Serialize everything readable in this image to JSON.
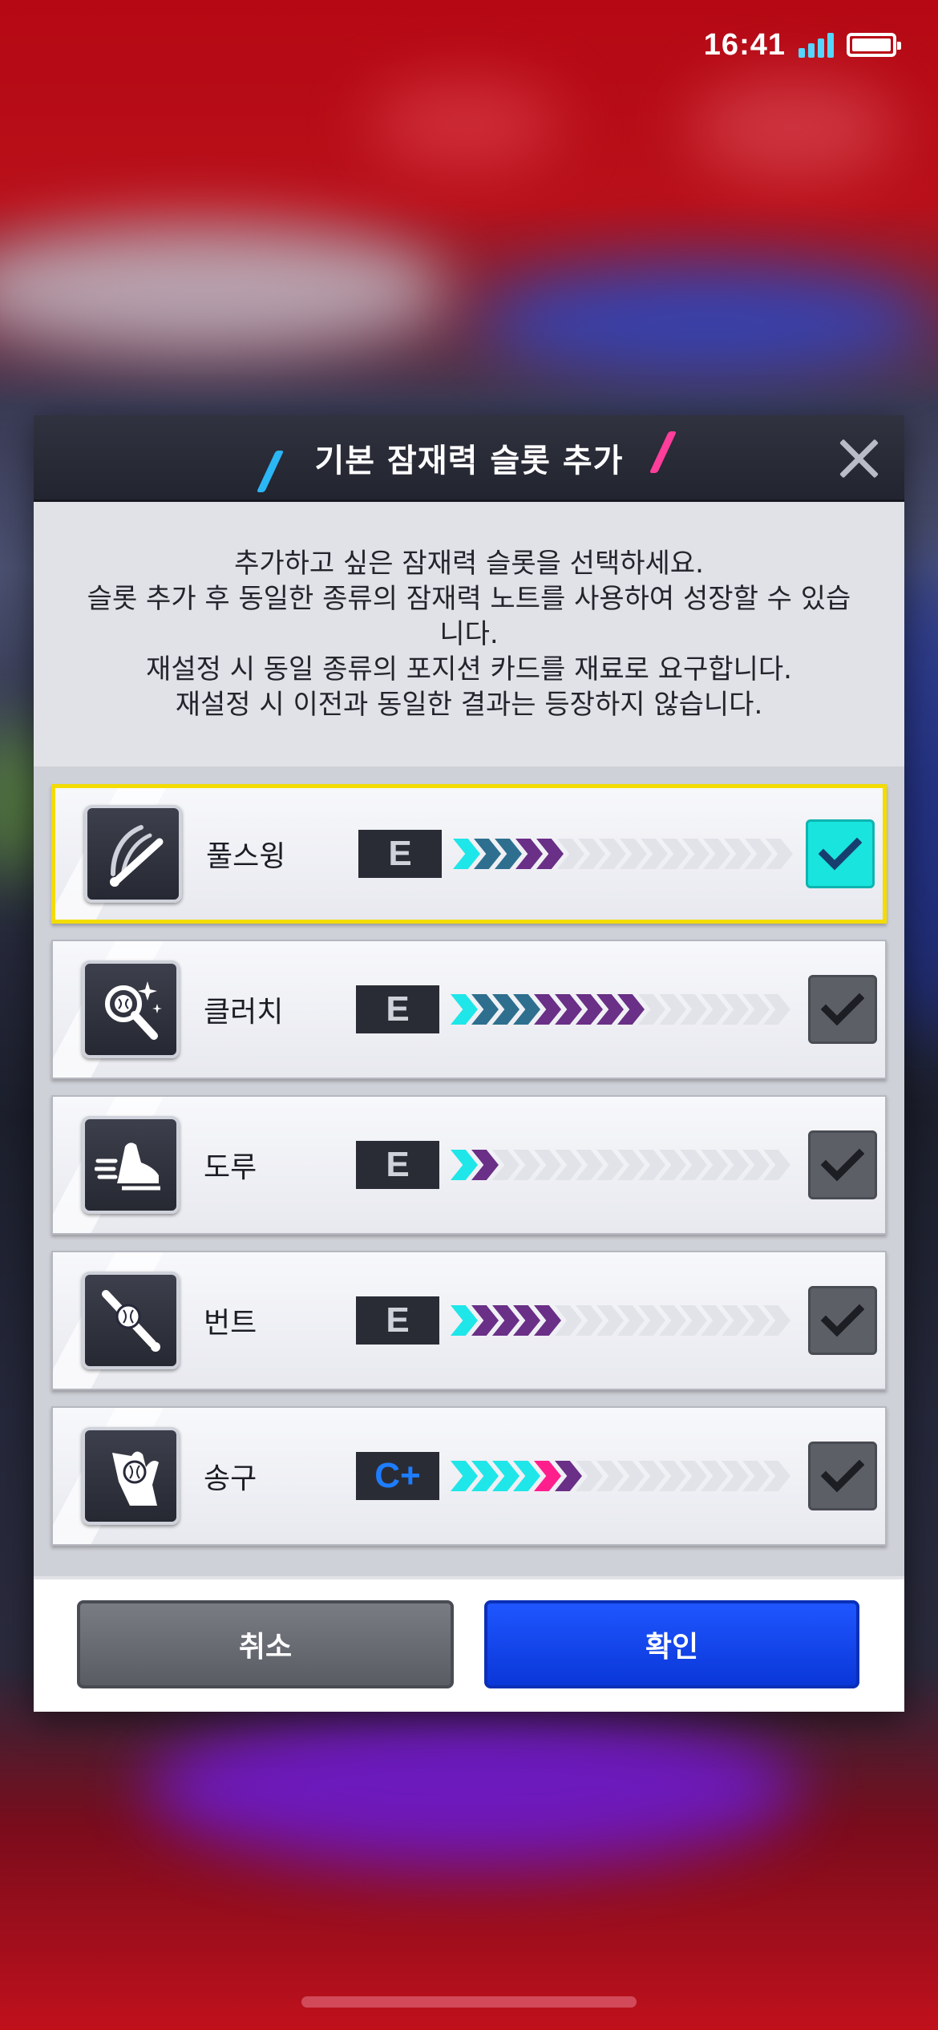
{
  "status_bar": {
    "time": "16:41"
  },
  "dialog": {
    "title": "기본 잠재력 슬롯 추가",
    "description": "추가하고 싶은 잠재력 슬롯을 선택하세요.\n슬롯 추가 후 동일한 종류의 잠재력 노트를 사용하여 성장할 수 있습니다.\n재설정 시 동일 종류의 포지션 카드를 재료로 요구합니다.\n재설정 시 이전과 동일한 결과는 등장하지 않습니다.",
    "slots": [
      {
        "name": "풀스윙",
        "grade": "E",
        "icon": "full-swing-bat-icon",
        "selected": true,
        "progress": [
          3,
          3,
          0,
          0,
          0,
          0,
          0,
          0,
          0,
          0,
          0,
          0,
          0,
          0,
          0,
          0,
          0,
          0
        ],
        "filled_cyan": 1,
        "filled_teal": 2,
        "filled_purple": 2
      },
      {
        "name": "클러치",
        "grade": "E",
        "icon": "clutch-magnifier-icon",
        "selected": false,
        "filled_cyan": 1,
        "filled_teal": 3,
        "filled_purple": 5
      },
      {
        "name": "도루",
        "grade": "E",
        "icon": "steal-shoe-icon",
        "selected": false,
        "filled_cyan": 1,
        "filled_teal": 0,
        "filled_purple": 1
      },
      {
        "name": "번트",
        "grade": "E",
        "icon": "bunt-bat-icon",
        "selected": false,
        "filled_cyan": 1,
        "filled_teal": 0,
        "filled_purple": 4
      },
      {
        "name": "송구",
        "grade": "C+",
        "icon": "throw-hand-icon",
        "selected": false,
        "filled_cyan": 4,
        "filled_teal": 0,
        "filled_purple": 0,
        "filled_pink": 1,
        "filled_purple_after": 1
      }
    ],
    "cancel_label": "취소",
    "confirm_label": "확인"
  },
  "colors": {
    "cyan": "#1fe6e8",
    "teal": "#2e6f8f",
    "purple": "#6a2f86",
    "pink": "#ff1f8c",
    "empty": "#e2e3e8",
    "selected_border": "#f3dc00",
    "confirm": "#0a3fe8"
  }
}
